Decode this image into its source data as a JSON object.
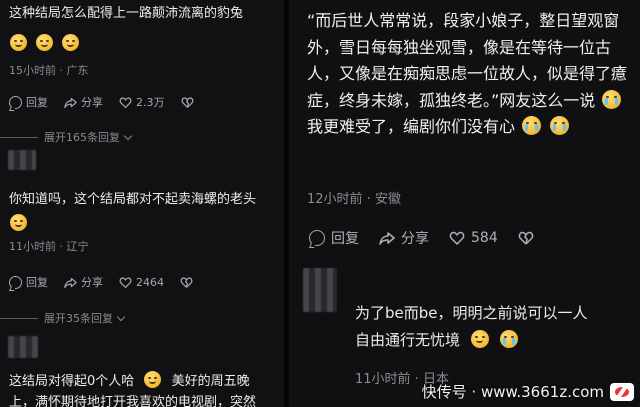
{
  "left": {
    "comment1": {
      "text": "这种结局怎么配得上一路颠沛流离的豹兔",
      "meta": "15小时前 · 广东",
      "reply_label": "回复",
      "share_label": "分享",
      "likes": "2.3万",
      "expand_label": "展开165条回复"
    },
    "comment2": {
      "text": "你知道吗，这个结局都对不起卖海螺的老头",
      "meta": "11小时前 · 辽宁",
      "reply_label": "回复",
      "share_label": "分享",
      "likes": "2464",
      "expand_label": "展开35条回复"
    },
    "comment3": {
      "line1a": "这结局对得起0个人哈",
      "line1b": "美好的周五晚",
      "line2": "上，满怀期待地打开我喜欢的电视剧，突然"
    }
  },
  "right": {
    "quote_pre": "“而后世人常常说，段家小娘子，整日望观窗外，雪日每每独坐观雪，像是在等待一位古人，又像是在痴痴思虑一位故人，似是得了癔症，终身未嫁，孤独终老。”网友这么一说",
    "quote_mid": "我更难受了，编剧你们没有心",
    "meta": "12小时前 · 安徽",
    "reply_label": "回复",
    "share_label": "分享",
    "likes": "584",
    "comment2_line1": "为了be而be，明明之前说可以一人",
    "comment2_line2": "自由通行无忧境",
    "comment2_meta": "11小时前 · 日本"
  },
  "watermark": {
    "text": "快传号 · www.3661z.com"
  },
  "icons": {
    "reply": "reply-icon",
    "share": "share-icon",
    "like": "heart-icon",
    "dislike": "broken-heart-icon",
    "chevron": "chevron-down-icon"
  }
}
